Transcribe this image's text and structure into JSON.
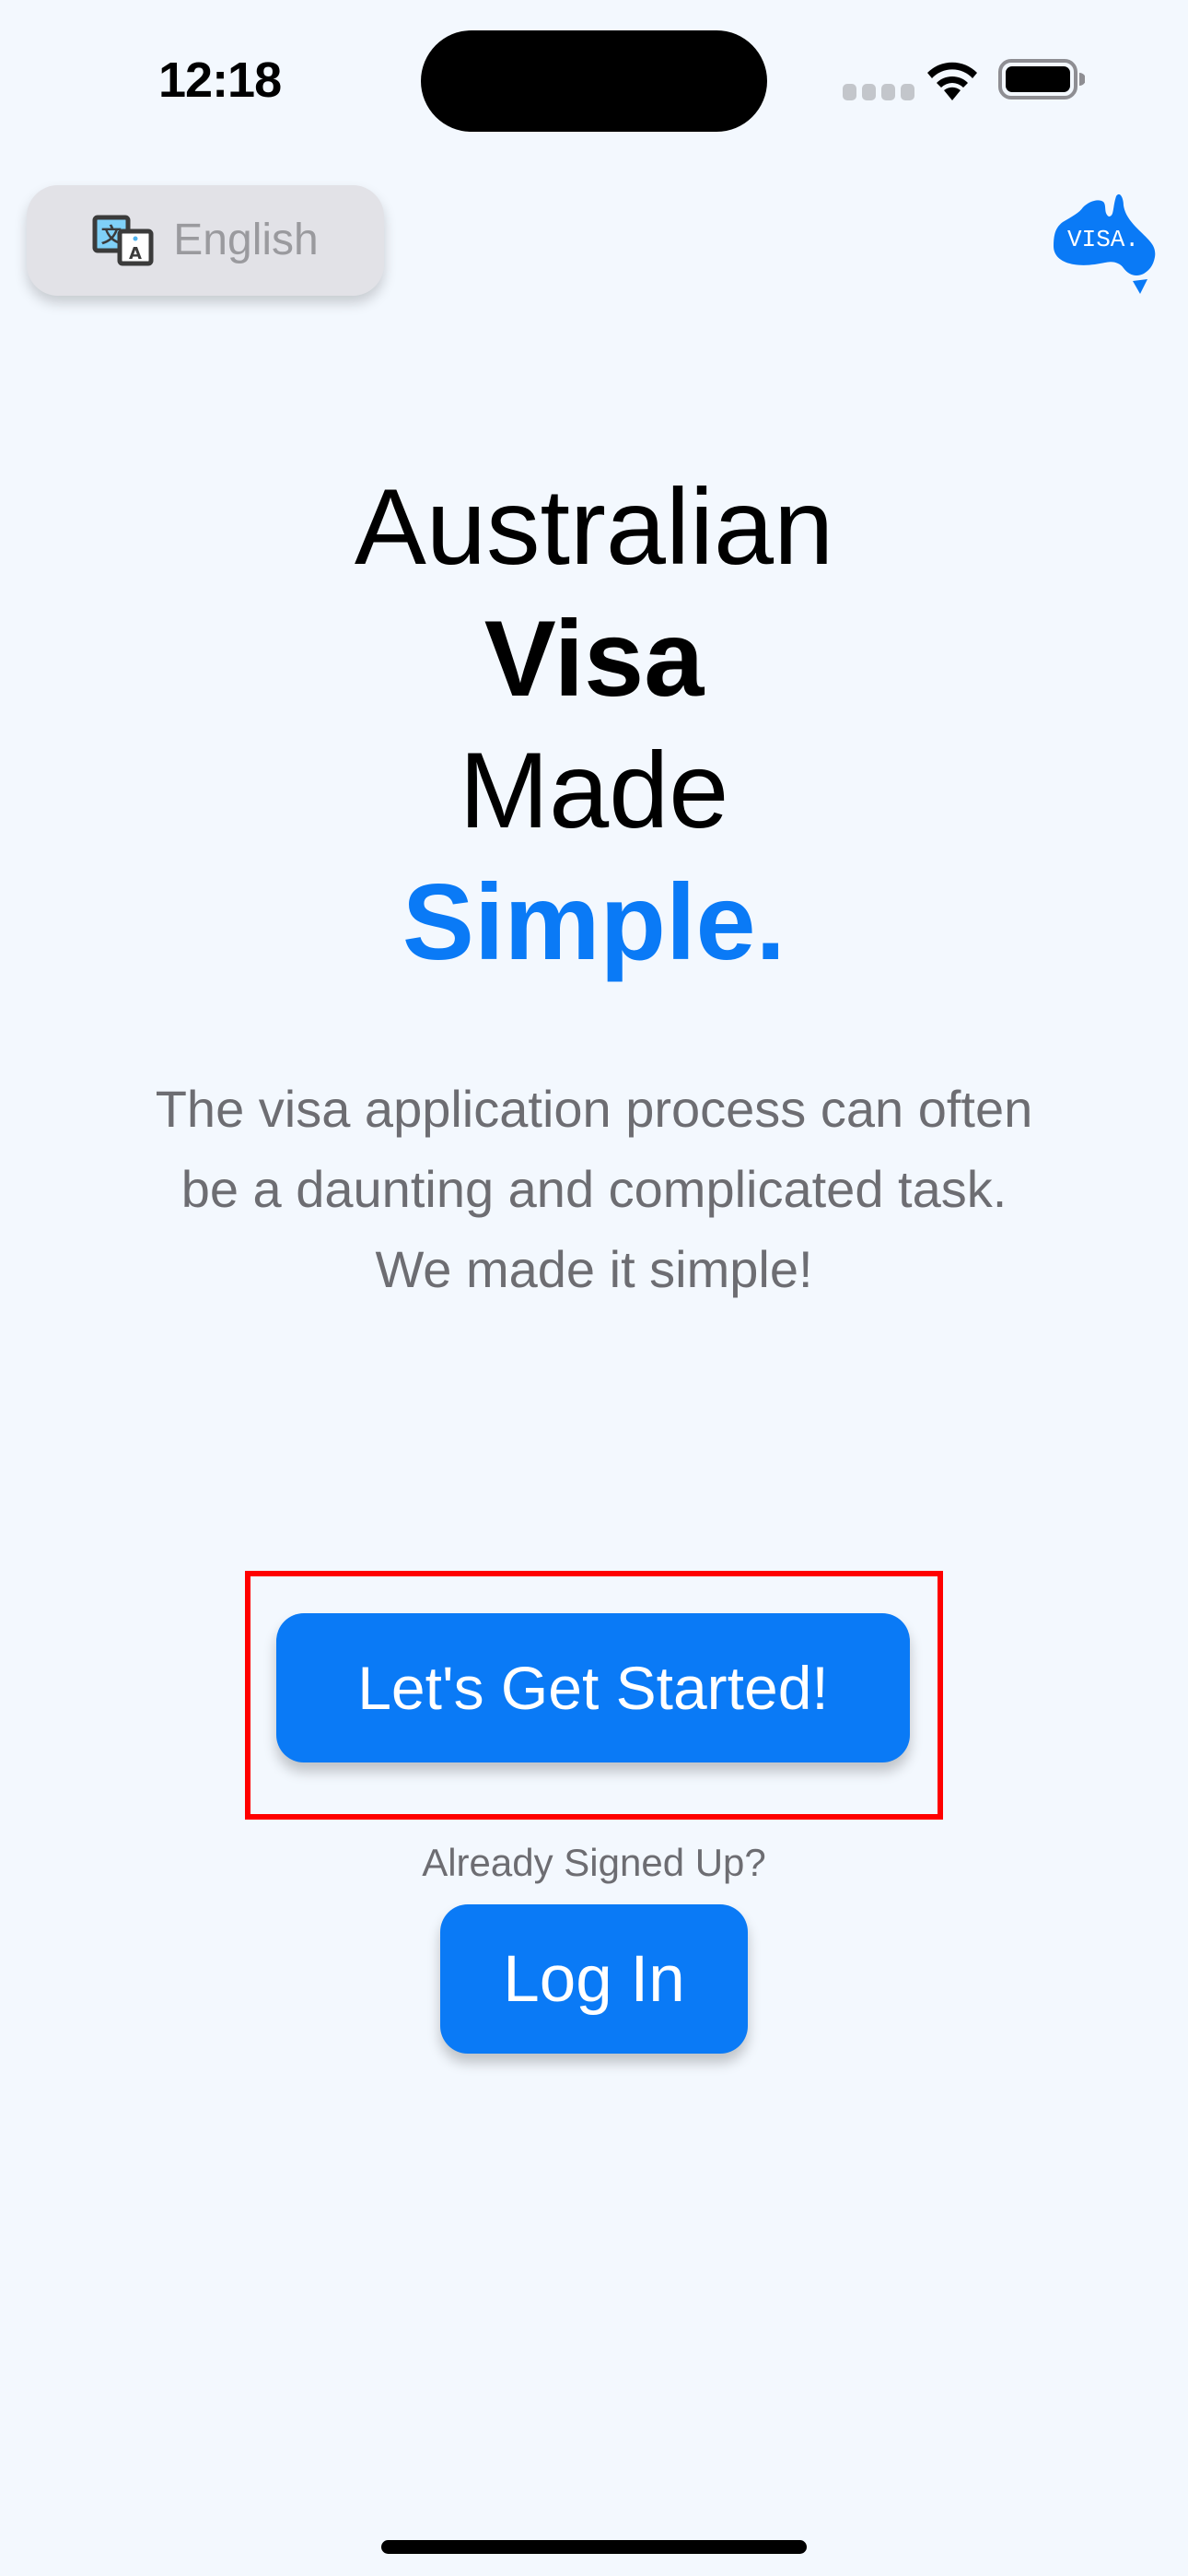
{
  "status_bar": {
    "time": "12:18",
    "signal_icon": "cellular-signal-icon",
    "wifi_icon": "wifi-icon",
    "battery_icon": "battery-icon"
  },
  "header": {
    "language_button": {
      "icon": "translate-icon",
      "label": "English"
    },
    "logo": {
      "icon": "australia-map-logo-icon",
      "text": "VISA."
    }
  },
  "hero": {
    "headline_lines": [
      "Australian",
      "Visa",
      "Made",
      "Simple."
    ],
    "tagline_lines": [
      "The visa application process can often",
      "be a daunting and complicated task.",
      "We made it simple!"
    ]
  },
  "actions": {
    "get_started_label": "Let's Get Started!",
    "already_signed_up_label": "Already Signed Up?",
    "login_label": "Log In"
  },
  "colors": {
    "accent": "#0a7af6",
    "background": "#f3f8fe",
    "highlight_box": "#ff0000",
    "secondary_text": "#6d6d72"
  }
}
